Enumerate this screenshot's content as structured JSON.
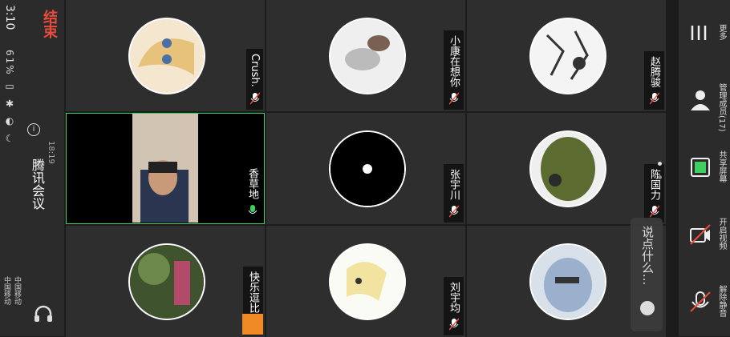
{
  "status_bar": {
    "time": "3:10",
    "battery": "61%",
    "carrier1": "中国移动",
    "carrier2": "中国移动"
  },
  "meeting": {
    "title": "腾讯会议",
    "elapsed": "18:19",
    "end_label": "结束"
  },
  "participants": [
    {
      "name": "Crush."
    },
    {
      "name": "小康在想你"
    },
    {
      "name": "赵腾骏"
    },
    {
      "name": "香草地"
    },
    {
      "name": "张宇川"
    },
    {
      "name": "陈国力"
    },
    {
      "name": "快乐逗比"
    },
    {
      "name": "刘宇均"
    },
    {
      "name": ""
    }
  ],
  "comment": {
    "placeholder": "说点什么..."
  },
  "toolbar": {
    "more": "更多",
    "manage": "管理成员(17)",
    "share": "共享屏幕",
    "video": "开启视频",
    "mute": "解除静音"
  },
  "colors": {
    "active_border": "#3ecf5e",
    "end": "#e84c3d",
    "share": "#3ecf5e"
  }
}
